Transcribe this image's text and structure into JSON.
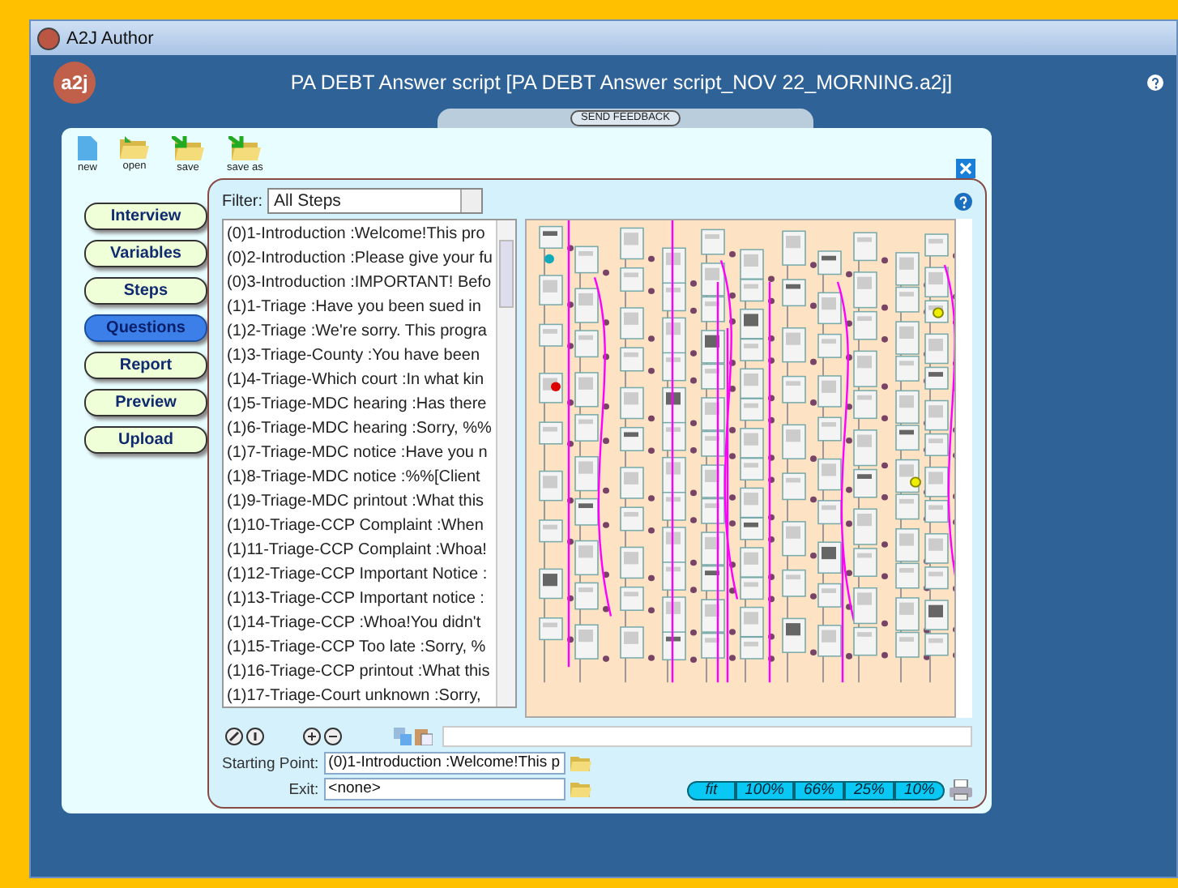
{
  "window": {
    "title": "A2J Author"
  },
  "header": {
    "logo": "a2j",
    "title": "PA DEBT Answer script [PA DEBT Answer script_NOV 22_MORNING.a2j]"
  },
  "feedback_button": "SEND FEEDBACK",
  "toolbar": [
    {
      "label": "new",
      "kind": "new"
    },
    {
      "label": "open",
      "kind": "open"
    },
    {
      "label": "save",
      "kind": "save"
    },
    {
      "label": "save as",
      "kind": "save"
    }
  ],
  "nav": [
    {
      "label": "Interview",
      "selected": false
    },
    {
      "label": "Variables",
      "selected": false
    },
    {
      "label": "Steps",
      "selected": false
    },
    {
      "label": "Questions",
      "selected": true
    },
    {
      "label": "Report",
      "selected": false
    },
    {
      "label": "Preview",
      "selected": false
    },
    {
      "label": "Upload",
      "selected": false
    }
  ],
  "filter": {
    "label": "Filter:",
    "value": "All Steps"
  },
  "questions": [
    "(0)1-Introduction :Welcome!This pro",
    "(0)2-Introduction :Please give your fu",
    "(0)3-Introduction :IMPORTANT! Befo",
    "(1)1-Triage :Have you been sued in",
    "(1)2-Triage :We're sorry. This progra",
    "(1)3-Triage-County :You have been",
    "(1)4-Triage-Which court :In what kin",
    "(1)5-Triage-MDC hearing :Has there",
    "(1)6-Triage-MDC hearing :Sorry, %%",
    "(1)7-Triage-MDC notice :Have you n",
    "(1)8-Triage-MDC notice :%%[Client",
    "(1)9-Triage-MDC printout :What this",
    "(1)10-Triage-CCP Complaint :When",
    "(1)11-Triage-CCP Complaint :Whoa!",
    "(1)12-Triage-CCP Important Notice :",
    "(1)13-Triage-CCP Important notice :",
    "(1)14-Triage-CCP :Whoa!You didn't",
    "(1)15-Triage-CCP Too late :Sorry, %",
    "(1)16-Triage-CCP printout :What this",
    "(1)17-Triage-Court unknown :Sorry,"
  ],
  "starting_point": {
    "label": "Starting Point:",
    "value": "(0)1-Introduction :Welcome!This p"
  },
  "exit": {
    "label": "Exit:",
    "value": "<none>"
  },
  "zoom_buttons": [
    "fit",
    "100%",
    "66%",
    "25%",
    "10%"
  ]
}
